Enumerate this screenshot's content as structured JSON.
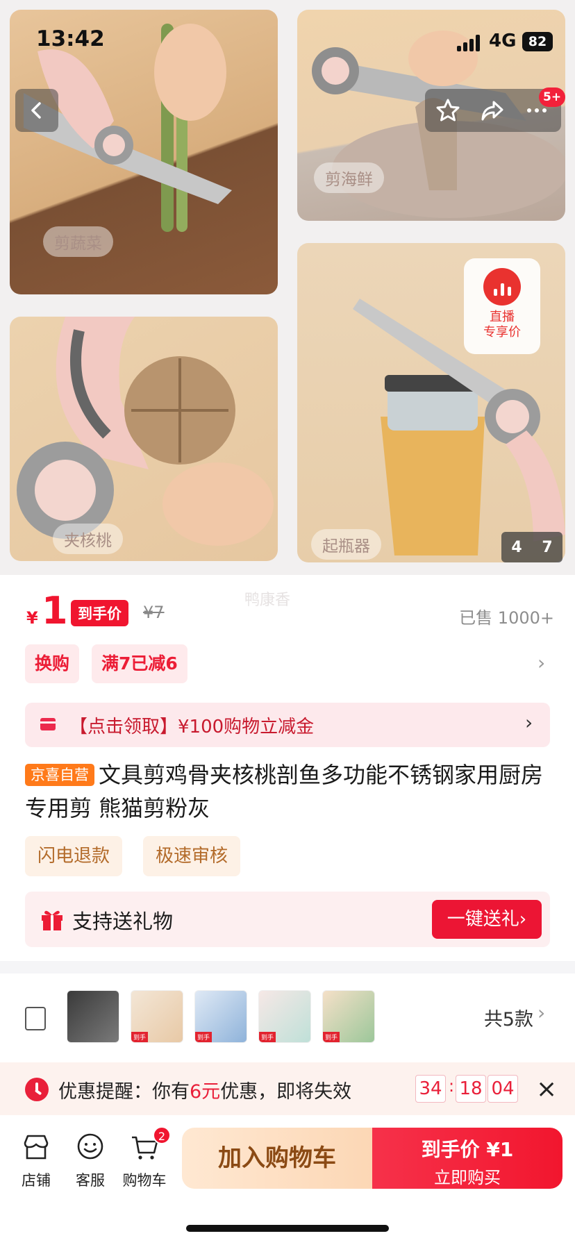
{
  "status_bar": {
    "time": "13:42",
    "network": "4G",
    "battery": "82"
  },
  "header": {
    "notification_count": "5+"
  },
  "gallery": {
    "captions": [
      "剪蔬菜",
      "剪海鲜",
      "夹核桃",
      "起瓶器"
    ],
    "live_badge": {
      "line1": "直播",
      "line2": "专享价"
    },
    "counter": {
      "current": "4",
      "total": "7"
    }
  },
  "price": {
    "currency": "¥",
    "value": "1",
    "tag": "到手价",
    "original": "¥7",
    "sold": "已售 1000+",
    "watermark": "鸭康香"
  },
  "promotions": [
    "换购",
    "满7已减6"
  ],
  "coupon": {
    "text": "【点击领取】¥100购物立减金"
  },
  "product": {
    "badge": "京喜自营",
    "title": "文具剪鸡骨夹核桃剖鱼多功能不锈钢家用厨房专用剪 熊猫剪粉灰"
  },
  "services": [
    "闪电退款",
    "极速审核"
  ],
  "gift": {
    "label": "支持送礼物",
    "button": "一键送礼›"
  },
  "variants": {
    "count": "共5款",
    "thumb_tag": "到手"
  },
  "reminder": {
    "prefix": "优惠提醒：你有",
    "amount": "6元",
    "suffix": "优惠，即将失效",
    "countdown": {
      "hours": "34",
      "minutes": "18",
      "seconds": "04"
    }
  },
  "bottom_bar": {
    "nav": [
      {
        "label": "店铺"
      },
      {
        "label": "客服"
      },
      {
        "label": "购物车",
        "badge": "2"
      }
    ],
    "add_to_cart": "加入购物车",
    "buy": {
      "line1": "到手价 ¥1",
      "line2": "立即购买"
    }
  },
  "colors": {
    "accent": "#f0152f",
    "promo_bg": "#feeaec",
    "service_text": "#b36b2a",
    "cart_btn": "#fcd7b5"
  }
}
